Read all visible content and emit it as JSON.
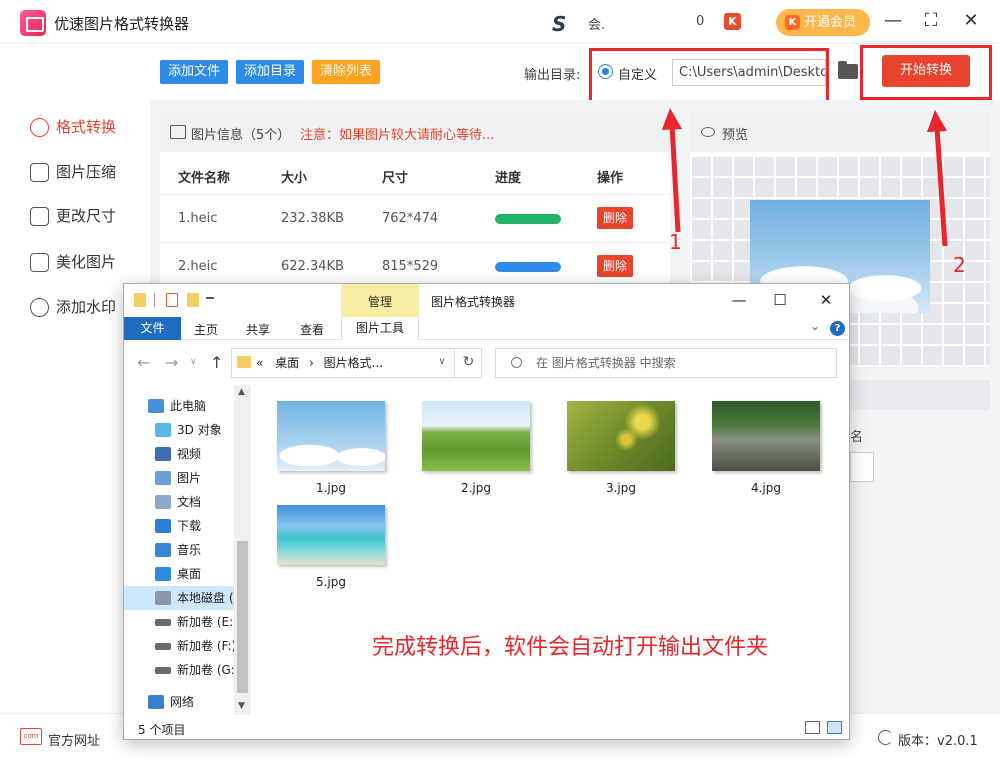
{
  "app": {
    "title": "优速图片格式转换器",
    "user_logo": "S",
    "user_name": "会.",
    "coin_count": "0",
    "coin_icon": "K",
    "vip_button": "开通会员",
    "vip_icon": "K",
    "controls": {
      "minimize": "—",
      "maximize": "⛶",
      "close": "✕"
    }
  },
  "sidebar": {
    "items": [
      {
        "label": "格式转换",
        "icon": "format-convert-icon",
        "active": true
      },
      {
        "label": "图片压缩",
        "icon": "compress-icon"
      },
      {
        "label": "更改尺寸",
        "icon": "resize-icon"
      },
      {
        "label": "美化图片",
        "icon": "beautify-icon"
      },
      {
        "label": "添加水印",
        "icon": "watermark-icon"
      }
    ]
  },
  "toolbar": {
    "add_file": "添加文件",
    "add_folder": "添加目录",
    "clear_list": "清除列表",
    "output_label": "输出目录:",
    "radio_custom": "自定义",
    "output_path": "C:\\Users\\admin\\Deskto",
    "start_button": "开始转换",
    "colors": {
      "blue": "#2d8ce8",
      "orange": "#ffa21f",
      "red": "#e8432c"
    }
  },
  "file_panel": {
    "title": "图片信息（5个）",
    "note": "注意：如果图片较大请耐心等待...",
    "headers": [
      "文件名称",
      "大小",
      "尺寸",
      "进度",
      "操作"
    ],
    "rows": [
      {
        "name": "1.heic",
        "size": "232.38KB",
        "dimensions": "762*474",
        "progress": 1.0,
        "progress_color": "#1fb46a",
        "action": "删除"
      },
      {
        "name": "2.heic",
        "size": "622.34KB",
        "dimensions": "815*529",
        "progress": 1.0,
        "progress_color": "#2d8ce8",
        "action": "删除"
      }
    ]
  },
  "preview": {
    "title": "预览"
  },
  "right_fragments": {
    "name_label": "名"
  },
  "footer": {
    "site_icon": "com",
    "site_link": "官方网址",
    "version": "版本：v2.0.1"
  },
  "explorer": {
    "manage_tab": "管理",
    "title": "图片格式转换器",
    "ribbon_tabs": [
      "文件",
      "主页",
      "共享",
      "查看"
    ],
    "picture_tools": "图片工具",
    "address": [
      "«",
      "桌面",
      "›",
      "图片格式..."
    ],
    "search_placeholder": "在 图片格式转换器 中搜索",
    "nav_items": [
      {
        "label": "此电脑",
        "color": "#4a90d9"
      },
      {
        "label": "3D 对象",
        "color": "#5bb6e8"
      },
      {
        "label": "视频",
        "color": "#3c6fb0"
      },
      {
        "label": "图片",
        "color": "#6aa0d8"
      },
      {
        "label": "文档",
        "color": "#8fa8c8"
      },
      {
        "label": "下载",
        "color": "#2a7fd4"
      },
      {
        "label": "音乐",
        "color": "#3b85d8"
      },
      {
        "label": "桌面",
        "color": "#2a8be0"
      },
      {
        "label": "本地磁盘 (",
        "color": "#8a97a8",
        "selected": true
      },
      {
        "label": "新加卷 (E:)",
        "color": "#6a6a6a"
      },
      {
        "label": "新加卷 (F:)",
        "color": "#6a6a6a"
      },
      {
        "label": "新加卷 (G:",
        "color": "#6a6a6a"
      },
      {
        "label": "网络",
        "color": "#3b7fd0"
      }
    ],
    "files": [
      {
        "name": "1.jpg",
        "theme": "sky-clouds"
      },
      {
        "name": "2.jpg",
        "theme": "green-meadow"
      },
      {
        "name": "3.jpg",
        "theme": "yellow-flowers"
      },
      {
        "name": "4.jpg",
        "theme": "forest-stream"
      },
      {
        "name": "5.jpg",
        "theme": "beach-sea"
      }
    ],
    "annotation": "完成转换后，软件会自动打开输出文件夹",
    "item_count": "5 个项目",
    "controls": {
      "minimize": "—",
      "maximize": "☐",
      "close": "✕"
    }
  },
  "markers": {
    "one": "1",
    "two": "2"
  }
}
